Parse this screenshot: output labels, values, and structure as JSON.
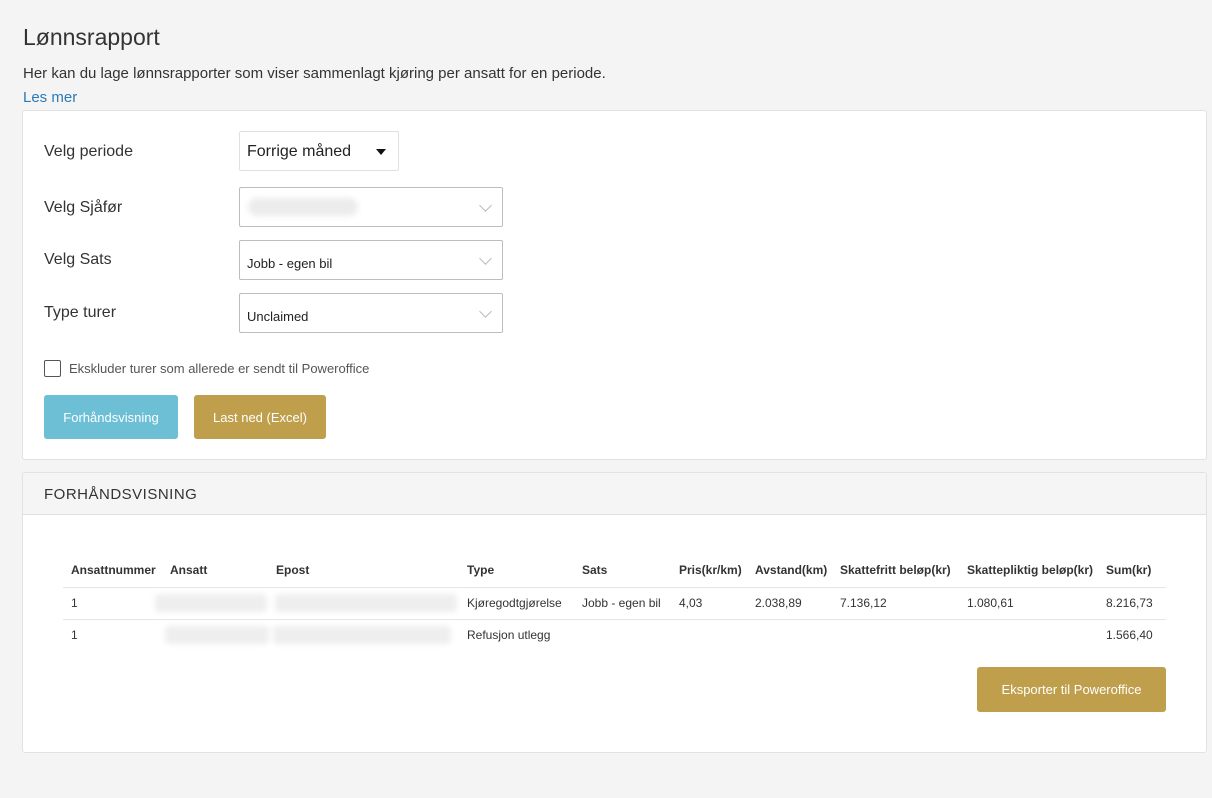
{
  "page": {
    "title": "Lønnsrapport",
    "intro": "Her kan du lage lønnsrapporter som viser sammenlagt kjøring per ansatt for en periode.",
    "read_more": "Les mer"
  },
  "form": {
    "period_label": "Velg periode",
    "period_value": "Forrige måned",
    "driver_label": "Velg Sjåfør",
    "driver_value": "",
    "rate_label": "Velg Sats",
    "rate_value": "Jobb - egen bil",
    "trip_type_label": "Type turer",
    "trip_type_value": "Unclaimed",
    "exclude_label": "Ekskluder turer som allerede er sendt til Poweroffice",
    "exclude_checked": false,
    "preview_button": "Forhåndsvisning",
    "download_button": "Last ned (Excel)"
  },
  "preview": {
    "header": "FORHÅNDSVISNING",
    "columns": [
      "Ansattnummer",
      "Ansatt",
      "Epost",
      "Type",
      "Sats",
      "Pris(kr/km)",
      "Avstand(km)",
      "Skattefritt beløp(kr)",
      "Skattepliktig beløp(kr)",
      "Sum(kr)"
    ],
    "rows": [
      {
        "ansattnummer": "1",
        "ansatt": "",
        "epost": "",
        "type": "Kjøregodtgjørelse",
        "sats": "Jobb - egen bil",
        "pris": "4,03",
        "avstand": "2.038,89",
        "skattefritt": "7.136,12",
        "skattepliktig": "1.080,61",
        "sum": "8.216,73"
      },
      {
        "ansattnummer": "1",
        "ansatt": "",
        "epost": "",
        "type": "Refusjon utlegg",
        "sats": "",
        "pris": "",
        "avstand": "",
        "skattefritt": "",
        "skattepliktig": "",
        "sum": "1.566,40"
      }
    ],
    "export_button": "Eksporter til Poweroffice"
  },
  "colors": {
    "preview_button": "#6cbfd5",
    "gold_button": "#bf9f4c",
    "link": "#2a7ab9"
  }
}
